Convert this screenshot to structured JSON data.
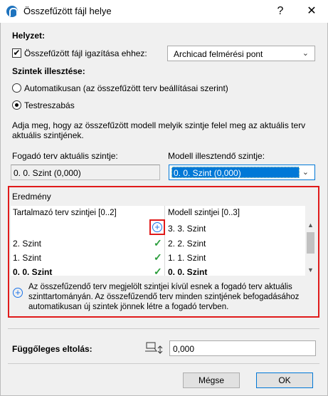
{
  "window": {
    "title": "Összefűzött fájl helye",
    "help_label": "?",
    "close_label": "✕"
  },
  "position": {
    "heading": "Helyzet:",
    "align_checkbox_label": "Összefűzött fájl igazítása ehhez:",
    "align_checked": true,
    "align_select_value": "Archicad felmérési pont"
  },
  "levels": {
    "heading": "Szintek illesztése:",
    "radio_auto_label": "Automatikusan (az összefűzött terv beállításai szerint)",
    "radio_custom_label": "Testreszabás",
    "selected": "custom",
    "hint_line1": "Adja meg, hogy az összefűzött modell melyik szintje felel meg az aktuális terv",
    "hint_line2": "aktuális szintjének.",
    "host_label": "Fogadó terv aktuális szintje:",
    "host_value": "0. 0. Szint (0,000)",
    "model_label": "Modell illesztendő szintje:",
    "model_value": "0. 0. Szint (0,000)"
  },
  "result": {
    "heading": "Eredmény",
    "col_host": "Tartalmazó terv szintjei [0..2]",
    "col_model": "Modell szintjei [0..3]",
    "rows": [
      {
        "host": "",
        "model": "3. 3. Szint",
        "status": "add"
      },
      {
        "host": "2. Szint",
        "model": "2. 2. Szint",
        "status": "match"
      },
      {
        "host": "1. Szint",
        "model": "1. 1. Szint",
        "status": "match"
      },
      {
        "host": "0. 0. Szint",
        "model": "0. 0. Szint",
        "status": "match"
      }
    ],
    "info_line1": "Az összefűzendő terv megjelölt szintjei kívül esnek a fogadó terv aktuális",
    "info_line2": "szinttartományán. Az összefűzendő terv minden szintjének befogadásához",
    "info_line3": "automatikusan új szintek jönnek létre a fogadó tervben."
  },
  "offset": {
    "label": "Függőleges eltolás:",
    "value": "0,000"
  },
  "buttons": {
    "cancel": "Mégse",
    "ok": "OK"
  }
}
